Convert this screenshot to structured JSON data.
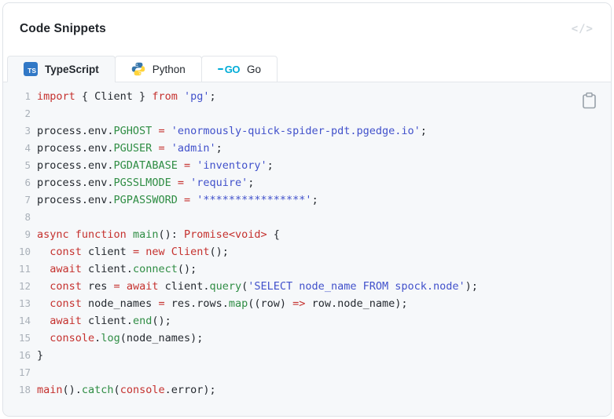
{
  "header": {
    "title": "Code Snippets",
    "code_icon": "</>"
  },
  "tabs": [
    {
      "id": "typescript",
      "label": "TypeScript",
      "badge": "TS",
      "active": true
    },
    {
      "id": "python",
      "label": "Python",
      "active": false
    },
    {
      "id": "go",
      "label": "Go",
      "badge": "GO",
      "active": false
    }
  ],
  "colors": {
    "keyword": "#c5312e",
    "string": "#4151cb",
    "function": "#2f8d44",
    "plain": "#24292f",
    "line_number": "#aab1b9",
    "code_bg": "#f6f8fa",
    "ts_blue": "#3178c6",
    "go_color": "#00acd7",
    "python_blue": "#3776ab",
    "python_yellow": "#ffd43b"
  },
  "code": {
    "language": "typescript",
    "lines": [
      {
        "n": 1,
        "t": [
          [
            "k",
            "import"
          ],
          [
            "p",
            " { Client } "
          ],
          [
            "k",
            "from"
          ],
          [
            "p",
            " "
          ],
          [
            "s",
            "'pg'"
          ],
          [
            "p",
            ";"
          ]
        ]
      },
      {
        "n": 2,
        "t": []
      },
      {
        "n": 3,
        "t": [
          [
            "p",
            "process.env."
          ],
          [
            "f",
            "PGHOST"
          ],
          [
            "p",
            " "
          ],
          [
            "k",
            "="
          ],
          [
            "p",
            " "
          ],
          [
            "s",
            "'enormously-quick-spider-pdt.pgedge.io'"
          ],
          [
            "p",
            ";"
          ]
        ]
      },
      {
        "n": 4,
        "t": [
          [
            "p",
            "process.env."
          ],
          [
            "f",
            "PGUSER"
          ],
          [
            "p",
            " "
          ],
          [
            "k",
            "="
          ],
          [
            "p",
            " "
          ],
          [
            "s",
            "'admin'"
          ],
          [
            "p",
            ";"
          ]
        ]
      },
      {
        "n": 5,
        "t": [
          [
            "p",
            "process.env."
          ],
          [
            "f",
            "PGDATABASE"
          ],
          [
            "p",
            " "
          ],
          [
            "k",
            "="
          ],
          [
            "p",
            " "
          ],
          [
            "s",
            "'inventory'"
          ],
          [
            "p",
            ";"
          ]
        ]
      },
      {
        "n": 6,
        "t": [
          [
            "p",
            "process.env."
          ],
          [
            "f",
            "PGSSLMODE"
          ],
          [
            "p",
            " "
          ],
          [
            "k",
            "="
          ],
          [
            "p",
            " "
          ],
          [
            "s",
            "'require'"
          ],
          [
            "p",
            ";"
          ]
        ]
      },
      {
        "n": 7,
        "t": [
          [
            "p",
            "process.env."
          ],
          [
            "f",
            "PGPASSWORD"
          ],
          [
            "p",
            " "
          ],
          [
            "k",
            "="
          ],
          [
            "p",
            " "
          ],
          [
            "s",
            "'****************'"
          ],
          [
            "p",
            ";"
          ]
        ]
      },
      {
        "n": 8,
        "t": []
      },
      {
        "n": 9,
        "t": [
          [
            "k",
            "async"
          ],
          [
            "p",
            " "
          ],
          [
            "k",
            "function"
          ],
          [
            "p",
            " "
          ],
          [
            "f",
            "main"
          ],
          [
            "p",
            "(): "
          ],
          [
            "k",
            "Promise<void>"
          ],
          [
            "p",
            " {"
          ]
        ]
      },
      {
        "n": 10,
        "t": [
          [
            "p",
            "  "
          ],
          [
            "k",
            "const"
          ],
          [
            "p",
            " client "
          ],
          [
            "k",
            "="
          ],
          [
            "p",
            " "
          ],
          [
            "k",
            "new"
          ],
          [
            "p",
            " "
          ],
          [
            "k",
            "Client"
          ],
          [
            "p",
            "();"
          ]
        ]
      },
      {
        "n": 11,
        "t": [
          [
            "p",
            "  "
          ],
          [
            "k",
            "await"
          ],
          [
            "p",
            " client."
          ],
          [
            "f",
            "connect"
          ],
          [
            "p",
            "();"
          ]
        ]
      },
      {
        "n": 12,
        "t": [
          [
            "p",
            "  "
          ],
          [
            "k",
            "const"
          ],
          [
            "p",
            " res "
          ],
          [
            "k",
            "="
          ],
          [
            "p",
            " "
          ],
          [
            "k",
            "await"
          ],
          [
            "p",
            " client."
          ],
          [
            "f",
            "query"
          ],
          [
            "p",
            "("
          ],
          [
            "s",
            "'SELECT node_name FROM spock.node'"
          ],
          [
            "p",
            ");"
          ]
        ]
      },
      {
        "n": 13,
        "t": [
          [
            "p",
            "  "
          ],
          [
            "k",
            "const"
          ],
          [
            "p",
            " node_names "
          ],
          [
            "k",
            "="
          ],
          [
            "p",
            " res.rows."
          ],
          [
            "f",
            "map"
          ],
          [
            "p",
            "((row) "
          ],
          [
            "k",
            "=>"
          ],
          [
            "p",
            " row.node_name);"
          ]
        ]
      },
      {
        "n": 14,
        "t": [
          [
            "p",
            "  "
          ],
          [
            "k",
            "await"
          ],
          [
            "p",
            " client."
          ],
          [
            "f",
            "end"
          ],
          [
            "p",
            "();"
          ]
        ]
      },
      {
        "n": 15,
        "t": [
          [
            "p",
            "  "
          ],
          [
            "k",
            "console"
          ],
          [
            "p",
            "."
          ],
          [
            "f",
            "log"
          ],
          [
            "p",
            "(node_names);"
          ]
        ]
      },
      {
        "n": 16,
        "t": [
          [
            "p",
            "}"
          ]
        ]
      },
      {
        "n": 17,
        "t": []
      },
      {
        "n": 18,
        "t": [
          [
            "k",
            "main"
          ],
          [
            "p",
            "()."
          ],
          [
            "f",
            "catch"
          ],
          [
            "p",
            "("
          ],
          [
            "k",
            "console"
          ],
          [
            "p",
            ".error);"
          ]
        ]
      }
    ]
  }
}
